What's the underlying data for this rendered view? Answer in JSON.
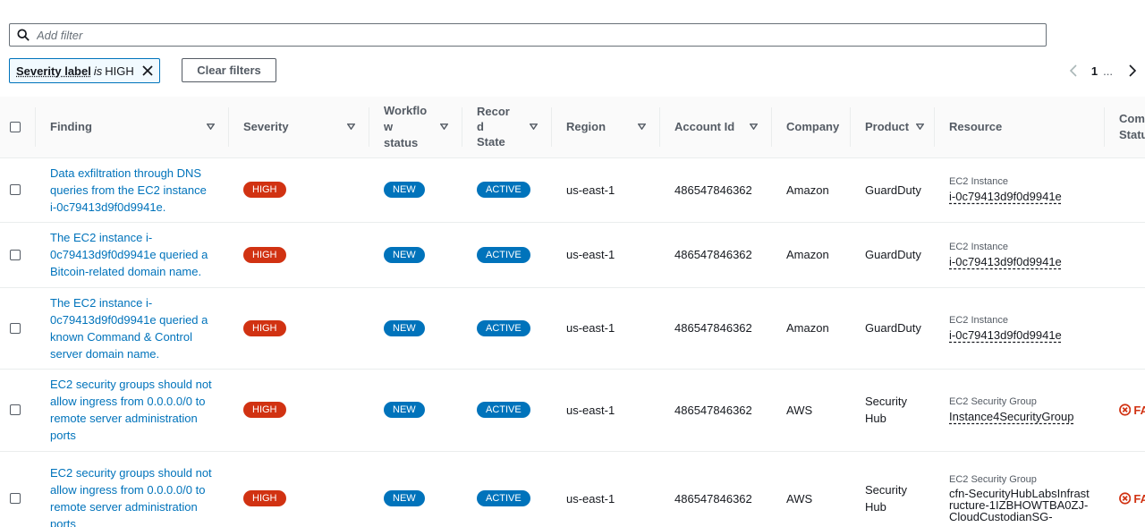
{
  "filter": {
    "placeholder": "Add filter"
  },
  "token": {
    "label": "Severity label",
    "operator": "is",
    "value": "HIGH"
  },
  "clear_filters_label": "Clear filters",
  "pager": {
    "current": "1",
    "dots": "..."
  },
  "columns": [
    "Finding",
    "Severity",
    "Workflo w status",
    "Recor d State",
    "Region",
    "Account Id",
    "Company",
    "Product",
    "Resource",
    "Comp Statu"
  ],
  "rows": [
    {
      "finding": "Data exfiltration through DNS queries from the EC2 instance i-0c79413d9f0d9941e.",
      "severity": "HIGH",
      "workflow": "NEW",
      "record": "ACTIVE",
      "region": "us-east-1",
      "account": "486547846362",
      "company": "Amazon",
      "product": "GuardDuty",
      "resource_type": "EC2 Instance",
      "resource_id": "i-0c79413d9f0d9941e",
      "compliance": ""
    },
    {
      "finding": "The EC2 instance i-0c79413d9f0d9941e queried a Bitcoin-related domain name.",
      "severity": "HIGH",
      "workflow": "NEW",
      "record": "ACTIVE",
      "region": "us-east-1",
      "account": "486547846362",
      "company": "Amazon",
      "product": "GuardDuty",
      "resource_type": "EC2 Instance",
      "resource_id": "i-0c79413d9f0d9941e",
      "compliance": ""
    },
    {
      "finding": "The EC2 instance i-0c79413d9f0d9941e queried a known Command & Control server domain name.",
      "severity": "HIGH",
      "workflow": "NEW",
      "record": "ACTIVE",
      "region": "us-east-1",
      "account": "486547846362",
      "company": "Amazon",
      "product": "GuardDuty",
      "resource_type": "EC2 Instance",
      "resource_id": "i-0c79413d9f0d9941e",
      "compliance": ""
    },
    {
      "finding": "EC2 security groups should not allow ingress from 0.0.0.0/0 to remote server administration ports",
      "severity": "HIGH",
      "workflow": "NEW",
      "record": "ACTIVE",
      "region": "us-east-1",
      "account": "486547846362",
      "company": "AWS",
      "product": "Security Hub",
      "resource_type": "EC2 Security Group",
      "resource_id": "Instance4SecurityGroup",
      "compliance": "FA"
    },
    {
      "finding": "EC2 security groups should not allow ingress from 0.0.0.0/0 to remote server administration ports",
      "severity": "HIGH",
      "workflow": "NEW",
      "record": "ACTIVE",
      "region": "us-east-1",
      "account": "486547846362",
      "company": "AWS",
      "product": "Security Hub",
      "resource_type": "EC2 Security Group",
      "resource_id": "cfn-SecurityHubLabsInfrastructure-1IZBHOWTBA0ZJ-CloudCustodianSG-",
      "compliance": "FA"
    }
  ],
  "colors": {
    "accent": "#0073bb",
    "high": "#d13212",
    "text": "#16191f",
    "muted": "#545b64"
  }
}
